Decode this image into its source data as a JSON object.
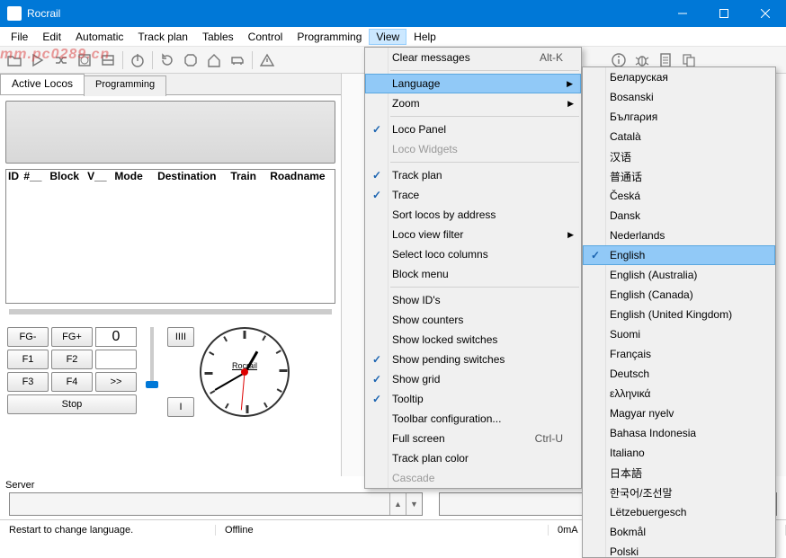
{
  "window": {
    "title": "Rocrail"
  },
  "menubar": [
    "File",
    "Edit",
    "Automatic",
    "Track plan",
    "Tables",
    "Control",
    "Programming",
    "View",
    "Help"
  ],
  "menubar_active": "View",
  "tabs": {
    "active": "Active Locos",
    "inactive": "Programming"
  },
  "watermark": "mm.pc0289.cn",
  "table_headers": [
    "ID",
    "#__",
    "Block",
    "V__",
    "Mode",
    "Destination",
    "Train",
    "Roadname"
  ],
  "controls": {
    "fg_minus": "FG-",
    "fg_plus": "FG+",
    "speed": "0",
    "f1": "F1",
    "f2": "F2",
    "f3": "F3",
    "f4": "F4",
    "forward": ">>",
    "stop": "Stop",
    "slider_top": "IIII",
    "slider_bottom": "I"
  },
  "clock_label": "Rocrail",
  "server_label": "Server",
  "statusbar": {
    "msg": "Restart to change language.",
    "status": "Offline",
    "current": "0mA"
  },
  "view_menu": [
    {
      "type": "item",
      "label": "Clear messages",
      "shortcut": "Alt-K"
    },
    {
      "type": "sep"
    },
    {
      "type": "item",
      "label": "Language",
      "submenu": true,
      "highlighted": true
    },
    {
      "type": "item",
      "label": "Zoom",
      "submenu": true
    },
    {
      "type": "sep"
    },
    {
      "type": "item",
      "label": "Loco Panel",
      "checked": true
    },
    {
      "type": "item",
      "label": "Loco Widgets",
      "disabled": true
    },
    {
      "type": "sep"
    },
    {
      "type": "item",
      "label": "Track plan",
      "checked": true
    },
    {
      "type": "item",
      "label": "Trace",
      "checked": true
    },
    {
      "type": "item",
      "label": "Sort locos by address"
    },
    {
      "type": "item",
      "label": "Loco view filter",
      "submenu": true
    },
    {
      "type": "item",
      "label": "Select loco columns"
    },
    {
      "type": "item",
      "label": "Block menu"
    },
    {
      "type": "sep"
    },
    {
      "type": "item",
      "label": "Show ID's"
    },
    {
      "type": "item",
      "label": "Show counters"
    },
    {
      "type": "item",
      "label": "Show locked switches"
    },
    {
      "type": "item",
      "label": "Show pending switches",
      "checked": true
    },
    {
      "type": "item",
      "label": "Show grid",
      "checked": true
    },
    {
      "type": "item",
      "label": "Tooltip",
      "checked": true
    },
    {
      "type": "item",
      "label": "Toolbar configuration..."
    },
    {
      "type": "item",
      "label": "Full screen",
      "shortcut": "Ctrl-U"
    },
    {
      "type": "item",
      "label": "Track plan color"
    },
    {
      "type": "item",
      "label": "Cascade",
      "disabled": true
    }
  ],
  "lang_menu": [
    "Беларуская",
    "Bosanski",
    "Бългаρия",
    "Català",
    "汉语",
    "普通话",
    "Česká",
    "Dansk",
    "Nederlands",
    "English",
    "English (Australia)",
    "English (Canada)",
    "English (United Kingdom)",
    "Suomi",
    "Français",
    "Deutsch",
    "ελληνικά",
    "Magyar nyelv",
    "Bahasa Indonesia",
    "Italiano",
    "日本語",
    "한국어/조선말",
    "Lëtzebuergesch",
    "Bokmål",
    "Polski"
  ],
  "lang_selected": "English"
}
